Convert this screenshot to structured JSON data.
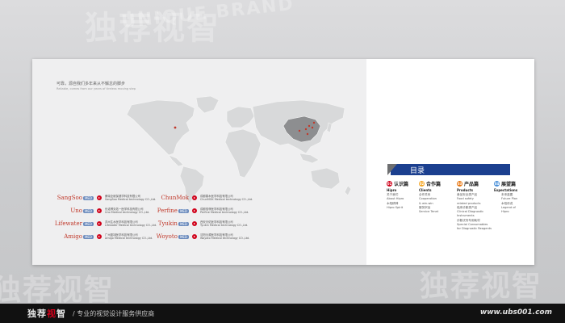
{
  "watermark": {
    "brand_cn": "独荐视智",
    "brand_en": "UNIQUE BRAND"
  },
  "left_page": {
    "tagline_cn": "可靠，源自我们多年来从不懈怠的脚步",
    "tagline_en": "Reliable, comes from our years of tireless moving step",
    "clients": [
      {
        "logo": "SangSoo",
        "logo_suffix": "MED",
        "name_cn": "桑瑞全维保健学科技有限公司",
        "name_en": "SangSoo Medical technology CO.,Ltd."
      },
      {
        "logo": "Uno",
        "logo_suffix": "MED",
        "name_cn": "优诺博克佑一医学科技有限公司",
        "name_en": "Uno Medical technology CO.,Ltd."
      },
      {
        "logo": "Lifewater",
        "logo_suffix": "MED",
        "name_cn": "苏州生水医学科技有限公司",
        "name_en": "Lifewater Medical technology CO.,Ltd."
      },
      {
        "logo": "Amigo",
        "logo_suffix": "MED",
        "name_cn": "广州盈翊医学科技有限公司",
        "name_en": "Amigo Medical technology CO.,Ltd."
      },
      {
        "logo": "ChunMok",
        "logo_suffix": "",
        "name_cn": "成都春木医学科技有限公司",
        "name_en": "ChunMOK Medical technology CO.,Ltd."
      },
      {
        "logo": "Perfine",
        "logo_suffix": "MED",
        "name_cn": "成都倍菲医学科技有限公司",
        "name_en": "Perfine Medical technology CO.,Ltd."
      },
      {
        "logo": "Tyukin",
        "logo_suffix": "MED",
        "name_cn": "西安天佑医学科技有限公司",
        "name_en": "Tyukin Medical technology CO.,Ltd."
      },
      {
        "logo": "Woyoto",
        "logo_suffix": "MED",
        "name_cn": "沈阳沃源医学科技有限公司",
        "name_en": "Woyoto Medical technology CO.,Ltd."
      }
    ]
  },
  "toc": {
    "title": "目录",
    "accent_color": "#1b3f8f",
    "sections": [
      {
        "badge": "01",
        "badge_color": "#d0021b",
        "title_cn": "认识篇",
        "title_en": "Hipro",
        "items": [
          "关于我们",
          "About Hipro",
          "木柏精神",
          "Hipro Spirit"
        ]
      },
      {
        "badge": "02",
        "badge_color": "#f5a623",
        "title_cn": "合作篇",
        "title_en": "Clients",
        "items": [
          "合作关系",
          "Cooperation",
          "& win-win",
          "服务宗旨",
          "Service Tenet"
        ]
      },
      {
        "badge": "03",
        "badge_color": "#e8740c",
        "title_cn": "产品篇",
        "title_en": "Products",
        "items": [
          "食品安全类产品",
          "Food safety",
          "related products",
          "临床诊断类产品",
          "Clinical Diagnostic",
          "Instruments",
          "诊断试剂专用耗材",
          "Special Consumables",
          "for Diagnostic Reagents"
        ]
      },
      {
        "badge": "04",
        "badge_color": "#4a90d9",
        "title_cn": "展望篇",
        "title_en": "Expectations",
        "items": [
          "未来蓝图",
          "Future Plan",
          "木柏传说",
          "Legend of",
          "Hipro"
        ]
      }
    ]
  },
  "footer": {
    "brand_part1": "独荐",
    "brand_part2": "视",
    "brand_part3": "智",
    "slogan": "/ 专业的视觉设计服务供应商",
    "url": "www.ubs001.com"
  }
}
